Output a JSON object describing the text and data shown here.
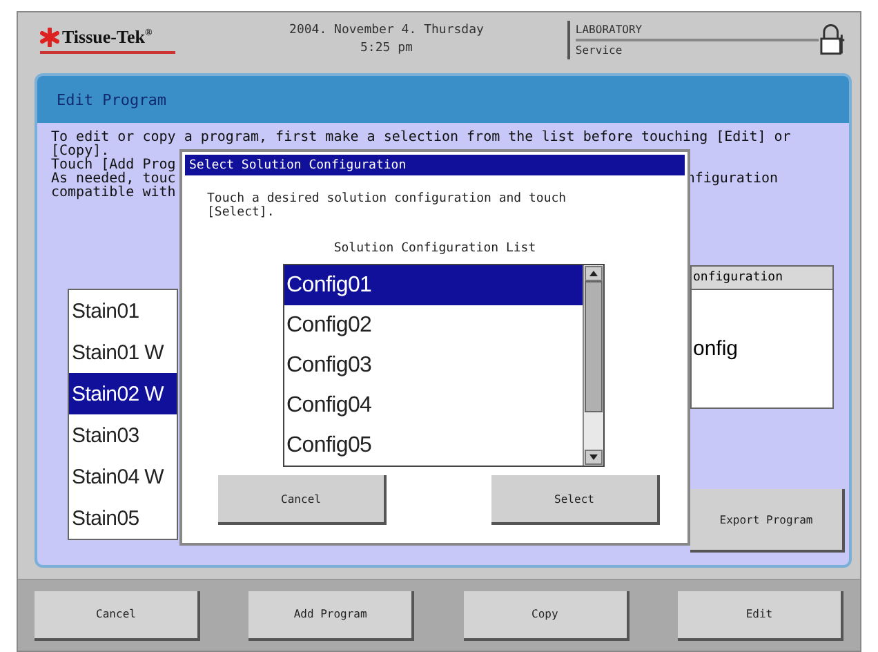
{
  "header": {
    "logo": "Tissue-Tek$^{®}$",
    "date": "2004. November 4. Thursday",
    "time": "5:25 pm",
    "facility": "LABORATORY",
    "user": "Service"
  },
  "panel": {
    "title": "Edit Program",
    "instructions": [
      {
        "left": "To edit or copy a program, first make a selection from the list before touching [Edit] or"
      },
      {
        "left": "[Copy]."
      },
      {
        "left": "Touch [Add Prog"
      },
      {
        "left": "As needed, touc",
        "right": "nfiguration"
      },
      {
        "left": "compatible with"
      }
    ],
    "programs": [
      {
        "name": "Stain01",
        "selected": false
      },
      {
        "name": "Stain01 W",
        "selected": false
      },
      {
        "name": "Stain02 W",
        "selected": true
      },
      {
        "name": "Stain03",
        "selected": false
      },
      {
        "name": "Stain04 W",
        "selected": false
      },
      {
        "name": "Stain05",
        "selected": false
      }
    ],
    "configuration_table": {
      "header": "onfiguration",
      "cell": "onfig"
    },
    "export_button": "Export Program"
  },
  "dialog": {
    "title": "Select Solution Configuration",
    "message": "Touch a desired solution configuration and touch [Select].",
    "list_label": "Solution Configuration List",
    "items": [
      {
        "name": "Config01",
        "selected": true
      },
      {
        "name": "Config02",
        "selected": false
      },
      {
        "name": "Config03",
        "selected": false
      },
      {
        "name": "Config04",
        "selected": false
      },
      {
        "name": "Config05",
        "selected": false
      }
    ],
    "buttons": [
      "Cancel",
      "Select"
    ]
  },
  "buttons": [
    "Cancel",
    "Add Program",
    "Copy",
    "Edit"
  ]
}
